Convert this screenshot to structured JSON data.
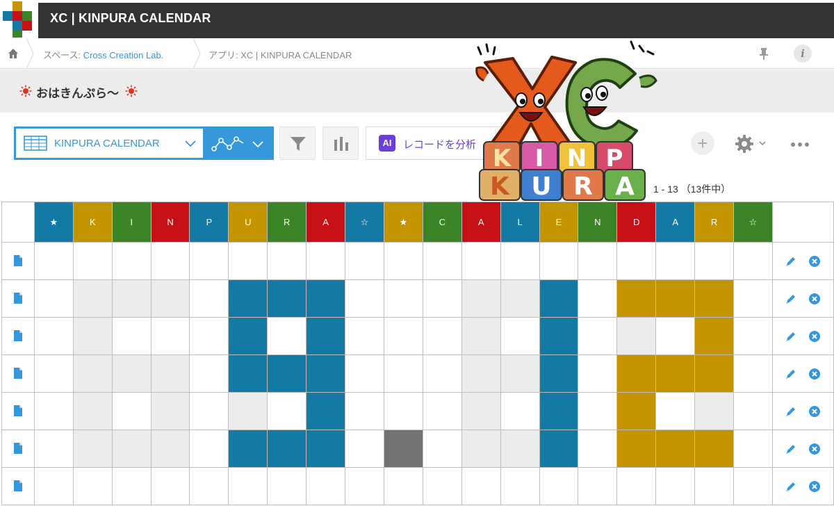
{
  "app": {
    "title": "XC | KINPURA CALENDAR"
  },
  "breadcrumb": {
    "space_prefix": "スペース: ",
    "space_name": "Cross Creation Lab.",
    "app_prefix": "アプリ: ",
    "app_name": "XC | KINPURA CALENDAR"
  },
  "header_icons": {
    "pin": "pin-icon",
    "info": "i"
  },
  "notice": {
    "text": "おはきんぷら〜"
  },
  "toolbar": {
    "view_name": "KINPURA CALENDAR",
    "graph_icon": "graph-icon",
    "filter_icon": "filter-icon",
    "chart_icon": "bar-chart-icon",
    "analyze_badge": "AI",
    "analyze_label": "レコードを分析",
    "add_label": "+",
    "record_count": "1 - 13 （13件中）"
  },
  "mascot": {
    "letters_top": "XC",
    "letters_middle": "KINP",
    "letters_bottom": "KURA"
  },
  "colors": {
    "blue": "#137aa6",
    "gold": "#c49400",
    "green": "#3b8528",
    "red": "#c70f16",
    "light": "#ececec",
    "dark": "#727272",
    "white": "#ffffff",
    "accent": "#3498db"
  },
  "grid": {
    "headers": [
      {
        "label": "★",
        "color": "blue"
      },
      {
        "label": "K",
        "color": "gold"
      },
      {
        "label": "I",
        "color": "green"
      },
      {
        "label": "N",
        "color": "red"
      },
      {
        "label": "P",
        "color": "blue"
      },
      {
        "label": "U",
        "color": "gold"
      },
      {
        "label": "R",
        "color": "green"
      },
      {
        "label": "A",
        "color": "red"
      },
      {
        "label": "☆",
        "color": "blue"
      },
      {
        "label": "★",
        "color": "gold"
      },
      {
        "label": "C",
        "color": "green"
      },
      {
        "label": "A",
        "color": "red"
      },
      {
        "label": "L",
        "color": "blue"
      },
      {
        "label": "E",
        "color": "gold"
      },
      {
        "label": "N",
        "color": "green"
      },
      {
        "label": "D",
        "color": "red"
      },
      {
        "label": "A",
        "color": "blue"
      },
      {
        "label": "R",
        "color": "gold"
      },
      {
        "label": "☆",
        "color": "green"
      }
    ],
    "rows": [
      [
        "white",
        "white",
        "white",
        "white",
        "white",
        "white",
        "white",
        "white",
        "white",
        "white",
        "white",
        "white",
        "white",
        "white",
        "white",
        "white",
        "white",
        "white",
        "white"
      ],
      [
        "white",
        "light",
        "light",
        "light",
        "white",
        "blue",
        "blue",
        "blue",
        "white",
        "white",
        "white",
        "light",
        "light",
        "blue",
        "white",
        "gold",
        "gold",
        "gold",
        "white"
      ],
      [
        "white",
        "light",
        "white",
        "white",
        "white",
        "blue",
        "white",
        "blue",
        "white",
        "white",
        "white",
        "light",
        "white",
        "blue",
        "white",
        "light",
        "white",
        "gold",
        "white"
      ],
      [
        "white",
        "light",
        "light",
        "light",
        "white",
        "blue",
        "blue",
        "blue",
        "white",
        "white",
        "white",
        "light",
        "light",
        "blue",
        "white",
        "gold",
        "gold",
        "gold",
        "white"
      ],
      [
        "white",
        "light",
        "white",
        "light",
        "white",
        "light",
        "white",
        "blue",
        "white",
        "white",
        "white",
        "light",
        "white",
        "blue",
        "white",
        "gold",
        "white",
        "light",
        "white"
      ],
      [
        "white",
        "light",
        "light",
        "light",
        "white",
        "blue",
        "blue",
        "blue",
        "white",
        "dark",
        "white",
        "light",
        "light",
        "blue",
        "white",
        "gold",
        "gold",
        "gold",
        "white"
      ],
      [
        "white",
        "white",
        "white",
        "white",
        "white",
        "white",
        "white",
        "white",
        "white",
        "white",
        "white",
        "white",
        "white",
        "white",
        "white",
        "white",
        "white",
        "white",
        "white"
      ]
    ]
  }
}
